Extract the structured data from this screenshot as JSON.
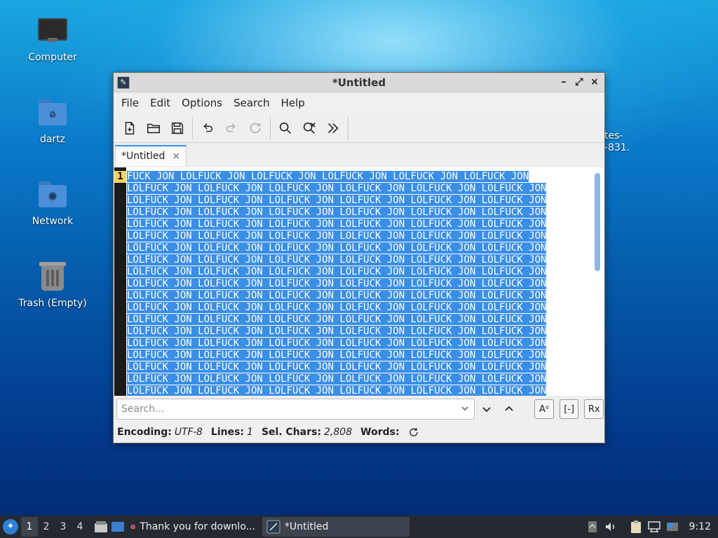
{
  "desktop": {
    "icons": [
      {
        "label": "Computer"
      },
      {
        "label": "dartz"
      },
      {
        "label": "Network"
      },
      {
        "label": "Trash (Empty)"
      }
    ],
    "partial_label_line1": "tes-",
    "partial_label_line2": "-831."
  },
  "window": {
    "title": "*Untitled",
    "controls": {
      "minimize": "–",
      "maximize": "⤢",
      "close": "×"
    },
    "menu": [
      "File",
      "Edit",
      "Options",
      "Search",
      "Help"
    ],
    "toolbar": [
      "new-file",
      "open-file",
      "save-file",
      "undo",
      "redo",
      "reload",
      "find",
      "find-replace",
      "more"
    ],
    "tab": {
      "label": "*Untitled",
      "close": "×"
    },
    "editor": {
      "line_number": "1",
      "first_line": "FUCK JON LOLFUCK JON LOLFUCK JON LOLFUCK JON LOLFUCK JON LOLFUCK JON",
      "wrapped_line": "LOLFUCK JON LOLFUCK JON LOLFUCK JON LOLFUCK JON LOLFUCK JON LOLFUCK JON",
      "selection_color": "#3a8ee6"
    },
    "find": {
      "placeholder": "Search...",
      "case_button": "Aᵅ",
      "whole_word_button": "[-]",
      "regex_button": "Rx"
    },
    "status": {
      "encoding_label": "Encoding:",
      "encoding_value": "UTF-8",
      "lines_label": "Lines:",
      "lines_value": "1",
      "sel_label": "Sel. Chars:",
      "sel_value": "2,808",
      "words_label": "Words:"
    }
  },
  "taskbar": {
    "workspaces": [
      "1",
      "2",
      "3",
      "4"
    ],
    "tasks": [
      {
        "label": "Thank you for downlo..."
      },
      {
        "label": "*Untitled"
      }
    ],
    "clock": "9:12"
  }
}
